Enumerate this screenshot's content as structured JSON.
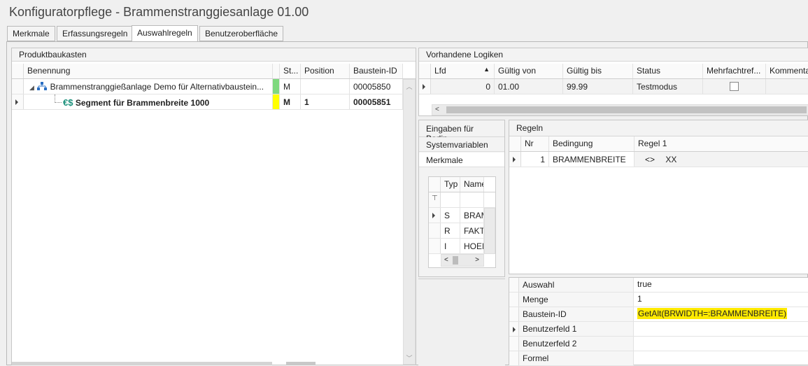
{
  "window": {
    "title": "Konfiguratorpflege - Brammenstranggiesanlage 01.00"
  },
  "tabs": [
    "Merkmale",
    "Erfassungsregeln",
    "Auswahlregeln",
    "Benutzeroberfläche"
  ],
  "active_tab": "Auswahlregeln",
  "produktbaukasten": {
    "header": "Produktbaukasten",
    "columns": [
      "Benennung",
      "St...",
      "Position",
      "Baustein-ID"
    ],
    "rows": [
      {
        "name": "Brammenstranggießanlage Demo für Alternativbaustein...",
        "status": "M",
        "position": "",
        "id": "00005850",
        "status_color": "#7fd97f",
        "icon": "hierarchy-icon",
        "bold": false
      },
      {
        "name": "Segment für Brammenbreite 1000",
        "status": "M",
        "position": "1",
        "id": "00005851",
        "status_color": "#ffff00",
        "icon": "euro-dollar-icon",
        "icon_text": "€$",
        "bold": true
      }
    ]
  },
  "logiken": {
    "header": "Vorhandene Logiken",
    "columns": [
      "Lfd",
      "Gültig von",
      "Gültig bis",
      "Status",
      "Mehrfachtref...",
      "Kommenta"
    ],
    "rows": [
      {
        "lfd": "0",
        "von": "01.00",
        "bis": "99.99",
        "status": "Testmodus",
        "mehrfach": false
      }
    ]
  },
  "eingaben": {
    "header": "Eingaben für Bedin",
    "items": [
      "Systemvariablen",
      "Merkmale"
    ],
    "columns": [
      "Typ",
      "Name"
    ],
    "rows": [
      {
        "typ": "S",
        "name": "BRAM"
      },
      {
        "typ": "R",
        "name": "FAKTO"
      },
      {
        "typ": "I",
        "name": "HOEH"
      }
    ]
  },
  "regeln": {
    "header": "Regeln",
    "columns": [
      "Nr",
      "Bedingung",
      "Regel 1"
    ],
    "rows": [
      {
        "nr": "1",
        "bedingung": "BRAMMENBREITE",
        "r1a": "<>",
        "r1b": "XX"
      }
    ]
  },
  "properties": [
    {
      "label": "Auswahl",
      "value": "true",
      "expandable": false,
      "highlight": false
    },
    {
      "label": "Menge",
      "value": "1",
      "expandable": false,
      "highlight": false
    },
    {
      "label": "Baustein-ID",
      "value": "GetAlt(BRWIDTH=:BRAMMENBREITE)",
      "expandable": false,
      "highlight": true
    },
    {
      "label": "Benutzerfeld 1",
      "value": "",
      "expandable": true,
      "highlight": false
    },
    {
      "label": "Benutzerfeld 2",
      "value": "",
      "expandable": false,
      "highlight": false
    },
    {
      "label": "Formel",
      "value": "",
      "expandable": false,
      "highlight": false
    }
  ]
}
